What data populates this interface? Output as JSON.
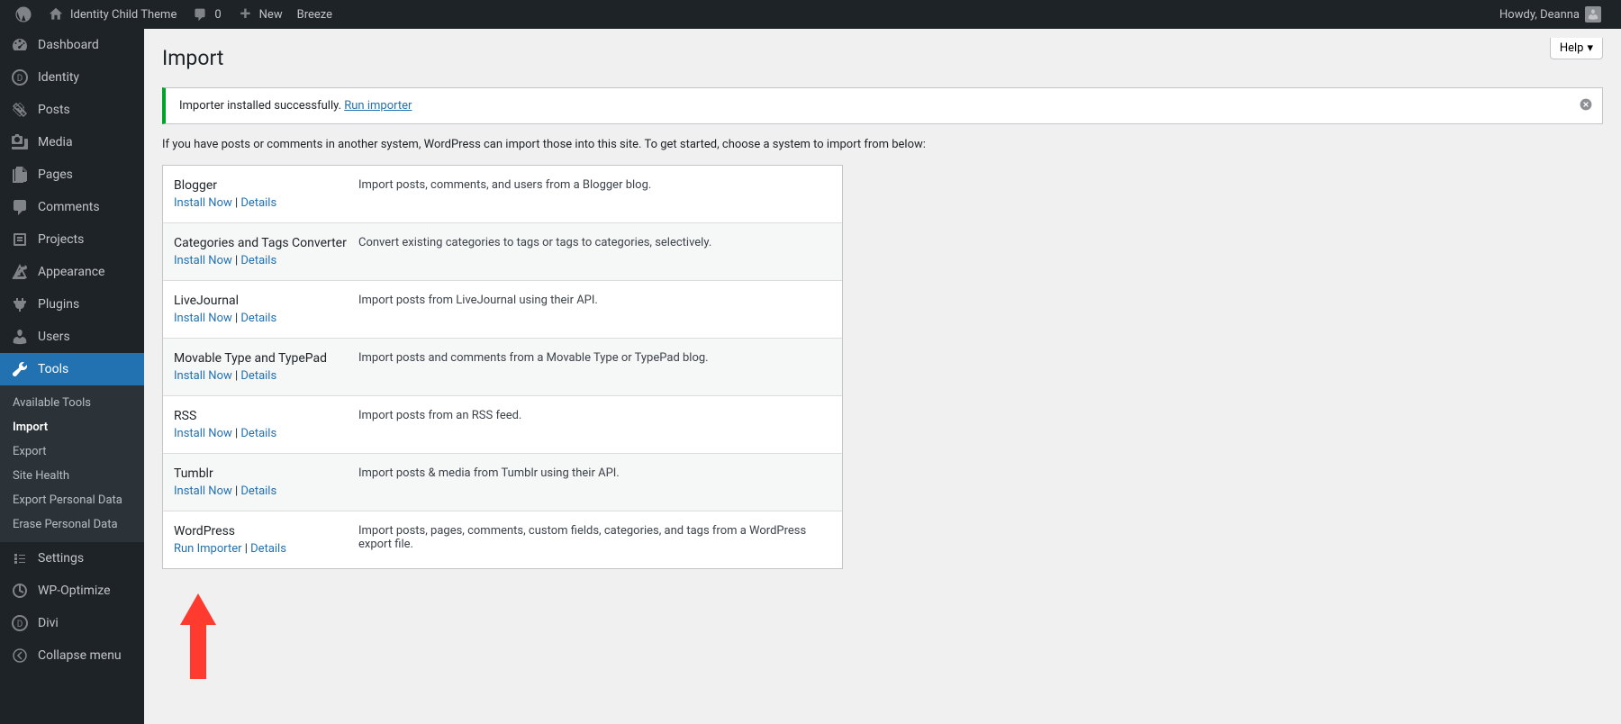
{
  "adminbar": {
    "site_title": "Identity Child Theme",
    "comments_count": "0",
    "new_label": "New",
    "breeze_label": "Breeze",
    "howdy": "Howdy, Deanna"
  },
  "sidebar": {
    "items": [
      {
        "label": "Dashboard",
        "icon": "dashboard"
      },
      {
        "label": "Identity",
        "icon": "identity"
      },
      {
        "label": "Posts",
        "icon": "posts"
      },
      {
        "label": "Media",
        "icon": "media"
      },
      {
        "label": "Pages",
        "icon": "pages"
      },
      {
        "label": "Comments",
        "icon": "comments"
      },
      {
        "label": "Projects",
        "icon": "projects"
      },
      {
        "label": "Appearance",
        "icon": "appearance"
      },
      {
        "label": "Plugins",
        "icon": "plugins"
      },
      {
        "label": "Users",
        "icon": "users"
      },
      {
        "label": "Tools",
        "icon": "tools",
        "current": true
      },
      {
        "label": "Settings",
        "icon": "settings"
      },
      {
        "label": "WP-Optimize",
        "icon": "wpoptimize"
      },
      {
        "label": "Divi",
        "icon": "divi"
      },
      {
        "label": "Collapse menu",
        "icon": "collapse"
      }
    ],
    "tools_submenu": [
      {
        "label": "Available Tools"
      },
      {
        "label": "Import",
        "current": true
      },
      {
        "label": "Export"
      },
      {
        "label": "Site Health"
      },
      {
        "label": "Export Personal Data"
      },
      {
        "label": "Erase Personal Data"
      }
    ]
  },
  "page": {
    "title": "Import",
    "help_label": "Help",
    "notice_text": "Importer installed successfully.",
    "notice_link": "Run importer",
    "intro": "If you have posts or comments in another system, WordPress can import those into this site. To get started, choose a system to import from below:"
  },
  "actions": {
    "install_now": "Install Now",
    "details": "Details",
    "run_importer": "Run Importer",
    "separator": " | "
  },
  "importers": [
    {
      "name": "Blogger",
      "desc": "Import posts, comments, and users from a Blogger blog.",
      "installed": false
    },
    {
      "name": "Categories and Tags Converter",
      "desc": "Convert existing categories to tags or tags to categories, selectively.",
      "installed": false
    },
    {
      "name": "LiveJournal",
      "desc": "Import posts from LiveJournal using their API.",
      "installed": false
    },
    {
      "name": "Movable Type and TypePad",
      "desc": "Import posts and comments from a Movable Type or TypePad blog.",
      "installed": false
    },
    {
      "name": "RSS",
      "desc": "Import posts from an RSS feed.",
      "installed": false
    },
    {
      "name": "Tumblr",
      "desc": "Import posts & media from Tumblr using their API.",
      "installed": false
    },
    {
      "name": "WordPress",
      "desc": "Import posts, pages, comments, custom fields, categories, and tags from a WordPress export file.",
      "installed": true
    }
  ]
}
